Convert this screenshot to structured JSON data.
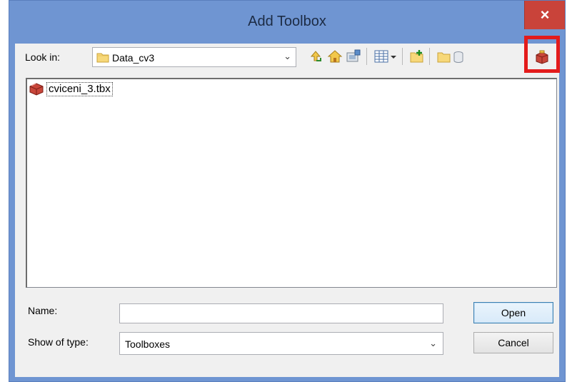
{
  "window": {
    "title": "Add Toolbox",
    "close_glyph": "×"
  },
  "look_in": {
    "label": "Look in:",
    "value": "Data_cv3",
    "icon": "folder-icon"
  },
  "toolbar": {
    "icons": [
      "up-one-level-icon",
      "home-icon",
      "connect-folder-icon",
      "view-list-icon",
      "view-dropdown-icon",
      "new-folder-icon",
      "folder-icon",
      "database-icon",
      "new-toolbox-icon"
    ]
  },
  "files": [
    {
      "name": "cviceni_3.tbx",
      "icon": "toolbox-icon"
    }
  ],
  "name_field": {
    "label": "Name:",
    "value": ""
  },
  "type_field": {
    "label": "Show of type:",
    "value": "Toolboxes"
  },
  "buttons": {
    "open": "Open",
    "cancel": "Cancel"
  },
  "colors": {
    "title_bar": "#6f95d2",
    "close": "#c9433a",
    "highlight": "#e31b1b"
  }
}
